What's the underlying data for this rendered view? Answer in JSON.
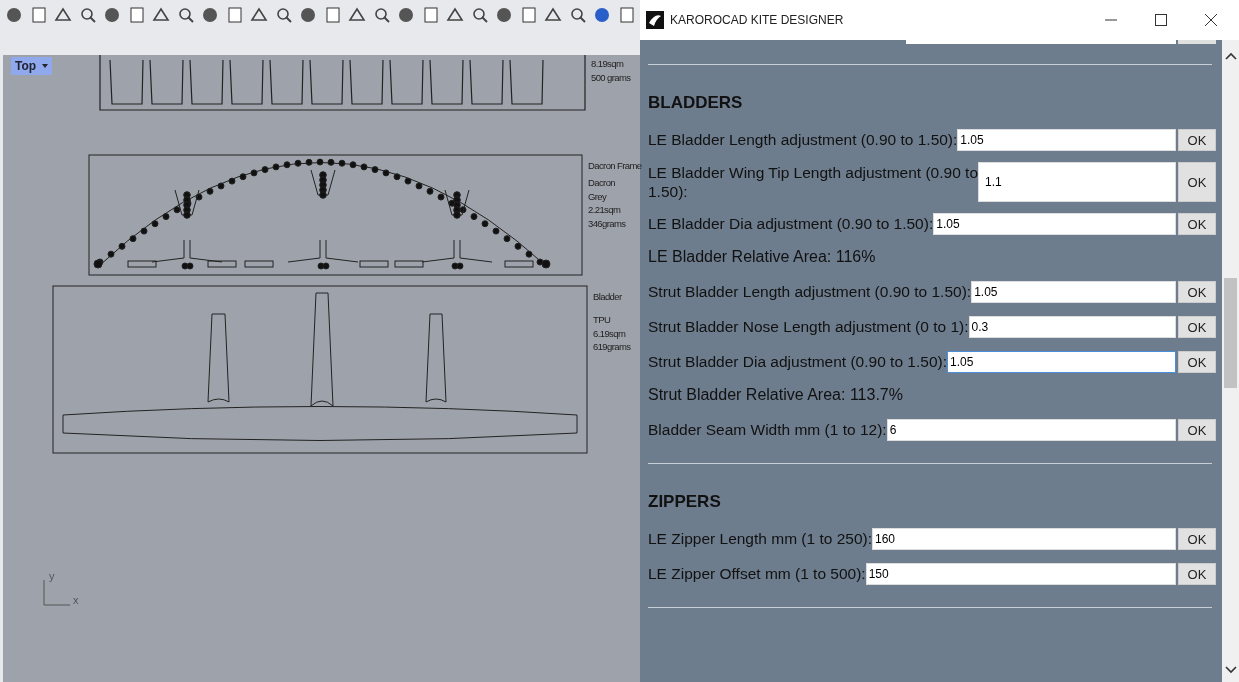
{
  "viewport": {
    "tab": "Top",
    "annotations": [
      {
        "lines": [
          "8.19sqm",
          "500 grams"
        ]
      },
      {
        "lines": [
          "Dacron Frame"
        ]
      },
      {
        "lines": [
          "Dacron",
          "Grey",
          "2.21sqm",
          "346grams"
        ]
      },
      {
        "lines": [
          "Bladder"
        ]
      },
      {
        "lines": [
          "TPU",
          "6.19sqm",
          "619grams"
        ]
      }
    ],
    "axis": {
      "y": "y",
      "x": "x"
    }
  },
  "window": {
    "title": "KAROROCAD KITE DESIGNER"
  },
  "rows": [
    {
      "kind": "divider"
    },
    {
      "kind": "heading",
      "text": "BLADDERS"
    },
    {
      "kind": "field",
      "label": "LE Bladder Length adjustment (0.90 to 1.50):",
      "value": "1.05",
      "button": "OK",
      "focused": false
    },
    {
      "kind": "field",
      "label": "LE Bladder Wing Tip Length adjustment (0.90 to 1.50):",
      "value": "1.1",
      "button": "OK",
      "focused": false,
      "wrap": true
    },
    {
      "kind": "field",
      "label": "LE Bladder Dia adjustment (0.90 to 1.50):",
      "value": "1.05",
      "button": "OK",
      "focused": false
    },
    {
      "kind": "readout",
      "text": "LE Bladder Relative Area: 116%"
    },
    {
      "kind": "field",
      "label": "Strut Bladder Length adjustment (0.90 to 1.50):",
      "value": "1.05",
      "button": "OK",
      "focused": false
    },
    {
      "kind": "field",
      "label": "Strut Bladder Nose Length adjustment (0 to 1):",
      "value": "0.3",
      "button": "OK",
      "focused": false
    },
    {
      "kind": "field",
      "label": "Strut Bladder Dia adjustment (0.90 to 1.50):",
      "value": "1.05",
      "button": "OK",
      "focused": true
    },
    {
      "kind": "readout",
      "text": "Strut Bladder Relative Area: 113.7%"
    },
    {
      "kind": "field",
      "label": "Bladder Seam Width mm (1 to 12):",
      "value": "6",
      "button": "OK",
      "focused": false
    },
    {
      "kind": "divider"
    },
    {
      "kind": "heading",
      "text": "ZIPPERS"
    },
    {
      "kind": "field",
      "label": "LE Zipper Length mm (1 to 250):",
      "value": "160",
      "button": "OK",
      "focused": false
    },
    {
      "kind": "field",
      "label": "LE Zipper Offset mm (1 to 500):",
      "value": "150",
      "button": "OK",
      "focused": false
    },
    {
      "kind": "divider"
    }
  ]
}
